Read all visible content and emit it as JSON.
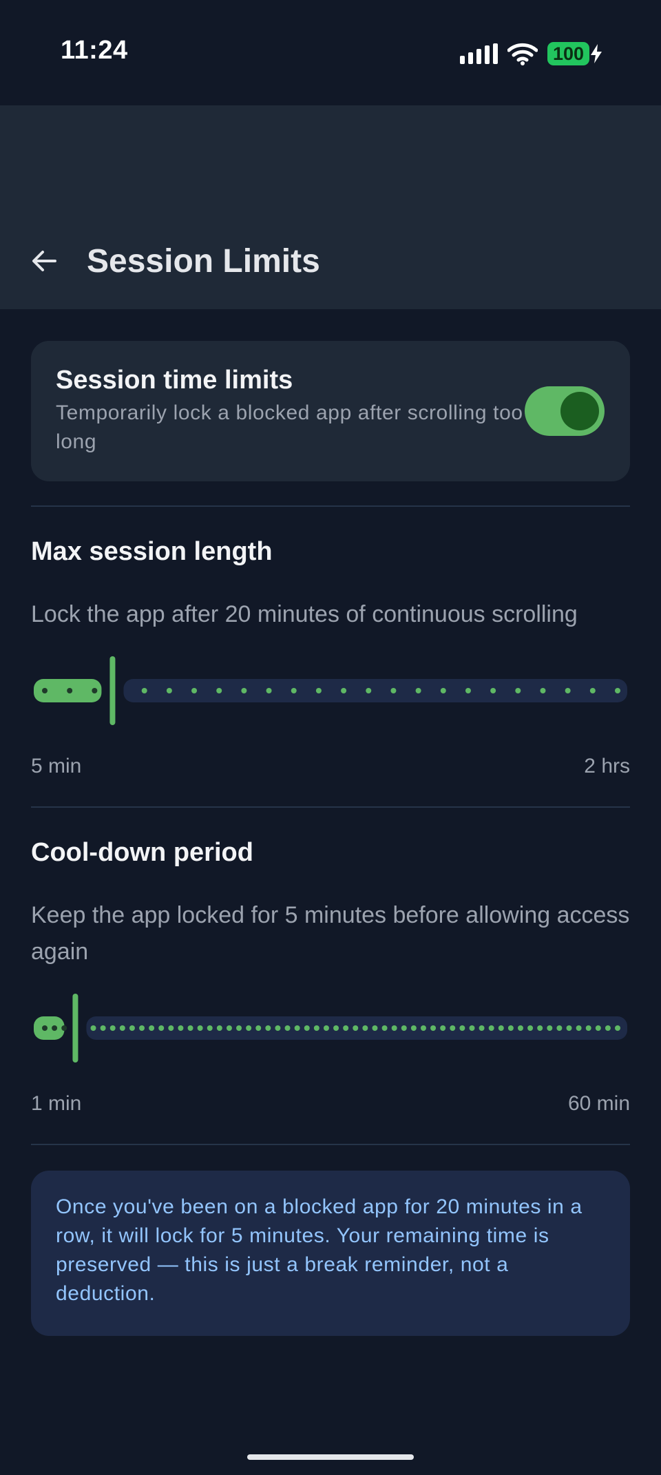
{
  "status_bar": {
    "time": "11:24",
    "battery": "100",
    "icons": [
      "signal-icon",
      "wifi-icon",
      "battery-icon",
      "charging-bolt-icon"
    ]
  },
  "app_bar": {
    "back_icon": "arrow-left-icon",
    "title": "Session Limits"
  },
  "session_toggle": {
    "title": "Session time limits",
    "description": "Temporarily lock a blocked app after scrolling too long",
    "enabled": true
  },
  "max_session": {
    "title": "Max session length",
    "description": "Lock the app after 20 minutes of continuous scrolling",
    "min_label": "5 min",
    "max_label": "2 hrs",
    "value": 20,
    "min": 5,
    "max": 120,
    "step": 5,
    "unit": "minutes"
  },
  "cooldown": {
    "title": "Cool-down period",
    "description": "Keep the app locked for 5 minutes before allowing access again",
    "min_label": "1 min",
    "max_label": "60 min",
    "value": 5,
    "min": 1,
    "max": 60,
    "step": 1,
    "unit": "minutes"
  },
  "info": {
    "text": "Once you've been on a blocked app for 20 minutes in a row, it will lock for 5 minutes. Your remaining time is preserved — this is just a break reminder, not a deduction."
  },
  "colors": {
    "background": "#111827",
    "surface": "#1f2937",
    "accent": "#5fb865",
    "accent_dark": "#1b5e20",
    "info_bg": "#1e2a47",
    "info_text": "#93c5fd"
  }
}
